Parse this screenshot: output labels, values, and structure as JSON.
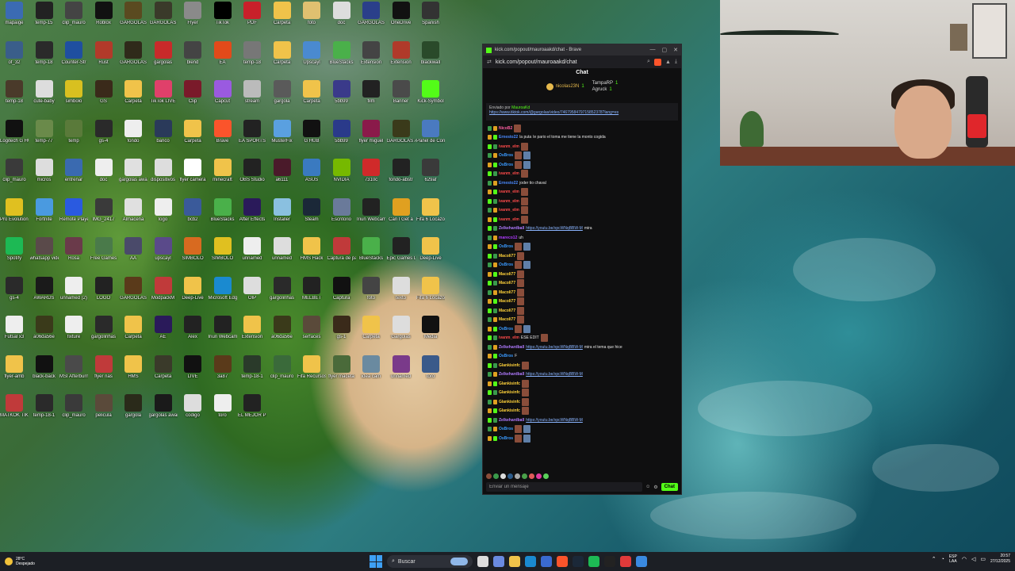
{
  "desktop": {
    "icons": [
      {
        "label": "mapaige",
        "color": "#3b6bb3"
      },
      {
        "label": "temp-15",
        "color": "#222"
      },
      {
        "label": "clip_mauro",
        "color": "#444"
      },
      {
        "label": "Roblox",
        "color": "#111"
      },
      {
        "label": "GARGOLAS",
        "color": "#5a4a20"
      },
      {
        "label": "GARGOLAS",
        "color": "#3a3a2a"
      },
      {
        "label": "Flyer",
        "color": "#8a8a8a"
      },
      {
        "label": "TikTok",
        "color": "#000"
      },
      {
        "label": "PDF",
        "color": "#c8202a"
      },
      {
        "label": "Carpeta",
        "color": "#f0c34a"
      },
      {
        "label": "foto",
        "color": "#e0c070"
      },
      {
        "label": "doc",
        "color": "#ddd"
      },
      {
        "label": "GARGOLAS",
        "color": "#2a3f8a"
      },
      {
        "label": "OneDrive",
        "color": "#111"
      },
      {
        "label": "Spanish",
        "color": "#333"
      },
      {
        "label": "of_32",
        "color": "#3a5e8a"
      },
      {
        "label": "temp-18",
        "color": "#2a2a2a"
      },
      {
        "label": "Counter-Str",
        "color": "#1f4fa0"
      },
      {
        "label": "Rust",
        "color": "#b23a2a"
      },
      {
        "label": "GARGOLAS",
        "color": "#2f2a1a"
      },
      {
        "label": "gargolas",
        "color": "#c82a2a"
      },
      {
        "label": "blend",
        "color": "#444"
      },
      {
        "label": "EA",
        "color": "#e24a1a"
      },
      {
        "label": "temp-18",
        "color": "#777"
      },
      {
        "label": "Carpeta",
        "color": "#f0c34a"
      },
      {
        "label": "Upscayl",
        "color": "#4a8ad0"
      },
      {
        "label": "BlueStacks",
        "color": "#4ab04a"
      },
      {
        "label": "Extension",
        "color": "#444"
      },
      {
        "label": "Extension",
        "color": "#b03a2a"
      },
      {
        "label": "blackwall",
        "color": "#2a4a2a"
      },
      {
        "label": "temp-18",
        "color": "#4a3a2a"
      },
      {
        "label": "cute-baby",
        "color": "#ddd"
      },
      {
        "label": "simbolo",
        "color": "#d8c020"
      },
      {
        "label": "GS",
        "color": "#3a2a1a"
      },
      {
        "label": "Carpeta",
        "color": "#f0c34a"
      },
      {
        "label": "TikTok LIVE",
        "color": "#e0406a"
      },
      {
        "label": "Clip",
        "color": "#7a1a2a"
      },
      {
        "label": "Capcut",
        "color": "#9a5ae0"
      },
      {
        "label": "stream",
        "color": "#bbb"
      },
      {
        "label": "gargola",
        "color": "#5a5a5a"
      },
      {
        "label": "Carpeta",
        "color": "#f0c34a"
      },
      {
        "label": "5bb99",
        "color": "#3a3a8a"
      },
      {
        "label": "film",
        "color": "#222"
      },
      {
        "label": "Banner",
        "color": "#4a4a4a"
      },
      {
        "label": "Kick-Symbol",
        "color": "#53fc18"
      },
      {
        "label": "Logitech G HUB",
        "color": "#111"
      },
      {
        "label": "temp-77",
        "color": "#6a8a4a"
      },
      {
        "label": "temp",
        "color": "#5a7a3a"
      },
      {
        "label": "gs-4",
        "color": "#2a2a2a"
      },
      {
        "label": "fondo",
        "color": "#eee"
      },
      {
        "label": "banco",
        "color": "#2a3a5a"
      },
      {
        "label": "Carpeta",
        "color": "#f0c34a"
      },
      {
        "label": "Brave",
        "color": "#fb542b"
      },
      {
        "label": "EA SPORTS",
        "color": "#222"
      },
      {
        "label": "MusterFix",
        "color": "#5aa0e0"
      },
      {
        "label": "G HUB",
        "color": "#111"
      },
      {
        "label": "5bb99",
        "color": "#2a3a8a"
      },
      {
        "label": "flyer miguel",
        "color": "#8a1a4a"
      },
      {
        "label": "GARGOLAS AWARDS",
        "color": "#3a3a1a"
      },
      {
        "label": "Panel de Control",
        "color": "#4a7ac0"
      },
      {
        "label": "clip_mauro",
        "color": "#3a3a3a"
      },
      {
        "label": "micros",
        "color": "#ddd"
      },
      {
        "label": "entrenar",
        "color": "#3a6ab0"
      },
      {
        "label": "doc",
        "color": "#eee"
      },
      {
        "label": "gargolas awards",
        "color": "#e0e0e0"
      },
      {
        "label": "dispositivos",
        "color": "#ddd"
      },
      {
        "label": "flyer camera",
        "color": "#fff"
      },
      {
        "label": "minecraft",
        "color": "#f0c34a"
      },
      {
        "label": "OBS Studio",
        "color": "#222"
      },
      {
        "label": "a6111",
        "color": "#4a1a2a"
      },
      {
        "label": "ASUS",
        "color": "#3a7ac0"
      },
      {
        "label": "NVIDIA",
        "color": "#76b900"
      },
      {
        "label": "7310c",
        "color": "#d02a2a"
      },
      {
        "label": "fondo-abstr",
        "color": "#222"
      },
      {
        "label": "629af",
        "color": "#3a3a3a"
      },
      {
        "label": "Pro Evolution Soccer",
        "color": "#e0c020"
      },
      {
        "label": "Fortnite",
        "color": "#4a9ae0"
      },
      {
        "label": "Remote Player",
        "color": "#2a5ae0"
      },
      {
        "label": "IMG_2417",
        "color": "#3a3a3a"
      },
      {
        "label": "Almacena",
        "color": "#e0e0e0"
      },
      {
        "label": "logo",
        "color": "#eee"
      },
      {
        "label": "bcb2",
        "color": "#3a5a9a"
      },
      {
        "label": "BlueStacks",
        "color": "#4ab04a"
      },
      {
        "label": "After Effects",
        "color": "#2a1a5a"
      },
      {
        "label": "Installer",
        "color": "#8ac0e0"
      },
      {
        "label": "Steam",
        "color": "#1b2838"
      },
      {
        "label": "Escritorio",
        "color": "#6a7a9a"
      },
      {
        "label": "Iriun Webcam",
        "color": "#222"
      },
      {
        "label": "Can I Get a",
        "color": "#e0a020"
      },
      {
        "label": "Fifa 6 Locazos",
        "color": "#f0c34a"
      },
      {
        "label": "Spotify",
        "color": "#1db954"
      },
      {
        "label": "whatsapp video",
        "color": "#5a4a4a"
      },
      {
        "label": "Rosa",
        "color": "#6a3a4a"
      },
      {
        "label": "Free Games",
        "color": "#4a7a4a"
      },
      {
        "label": "AA",
        "color": "#4a4a6a"
      },
      {
        "label": "upscayl",
        "color": "#5a4a8a"
      },
      {
        "label": "SIMBOLO",
        "color": "#d86a20"
      },
      {
        "label": "SIMBOLO",
        "color": "#e0c020"
      },
      {
        "label": "unnamed",
        "color": "#eee"
      },
      {
        "label": "unnamed",
        "color": "#ddd"
      },
      {
        "label": "HMS Hack",
        "color": "#f0c34a"
      },
      {
        "label": "Captura de pantalla",
        "color": "#c03a3a"
      },
      {
        "label": "BlueStacks",
        "color": "#4ab04a"
      },
      {
        "label": "Epic Games Launcher",
        "color": "#222"
      },
      {
        "label": "Deep-Live",
        "color": "#f0c34a"
      },
      {
        "label": "gs-4",
        "color": "#2a2a2a"
      },
      {
        "label": "AWARDS",
        "color": "#1a1a1a"
      },
      {
        "label": "unnamed (2)",
        "color": "#eee"
      },
      {
        "label": "LOGO",
        "color": "#222"
      },
      {
        "label": "GARGOLAS",
        "color": "#5a3a1a"
      },
      {
        "label": "ModpackM",
        "color": "#c03a3a"
      },
      {
        "label": "Deep-Live",
        "color": "#f0c34a"
      },
      {
        "label": "Microsoft Edge",
        "color": "#1a8ad0"
      },
      {
        "label": "OIP",
        "color": "#ddd"
      },
      {
        "label": "gargolinhas",
        "color": "#2a2a2a"
      },
      {
        "label": "MELBET",
        "color": "#222"
      },
      {
        "label": "Captura",
        "color": "#111"
      },
      {
        "label": "foto",
        "color": "#444"
      },
      {
        "label": "texto",
        "color": "#ddd"
      },
      {
        "label": "Fifa 6 Locazos",
        "color": "#f0c34a"
      },
      {
        "label": "Futsal x3",
        "color": "#eee"
      },
      {
        "label": "a06da56e",
        "color": "#3a3a1a"
      },
      {
        "label": "fixture",
        "color": "#eee"
      },
      {
        "label": "gargolinhas",
        "color": "#2a2a2a"
      },
      {
        "label": "Carpeta",
        "color": "#f0c34a"
      },
      {
        "label": "AE",
        "color": "#2a1a5a"
      },
      {
        "label": "Alex",
        "color": "#222"
      },
      {
        "label": "Iriun Webcam",
        "color": "#222"
      },
      {
        "label": "Extension",
        "color": "#f0c34a"
      },
      {
        "label": "a06da56e",
        "color": "#3a3a1a"
      },
      {
        "label": "serfaces",
        "color": "#5a4a3a"
      },
      {
        "label": "gs-1",
        "color": "#3a2a1a"
      },
      {
        "label": "Carpeta",
        "color": "#f0c34a"
      },
      {
        "label": "Gargolas",
        "color": "#ddd"
      },
      {
        "label": "Media",
        "color": "#111"
      },
      {
        "label": "flyer-amb",
        "color": "#f0c34a"
      },
      {
        "label": "black-back",
        "color": "#111"
      },
      {
        "label": "MSI Afterburner",
        "color": "#4a4a4a"
      },
      {
        "label": "flyer nas",
        "color": "#c03a3a"
      },
      {
        "label": "HMS",
        "color": "#f0c34a"
      },
      {
        "label": "Carpeta",
        "color": "#3a3a2a"
      },
      {
        "label": "LIVE",
        "color": "#111"
      },
      {
        "label": "3a87",
        "color": "#5a3a1a"
      },
      {
        "label": "temp-18-1",
        "color": "#2a3a2a"
      },
      {
        "label": "clip_mauro",
        "color": "#3a6a3a"
      },
      {
        "label": "Fifa Recursos",
        "color": "#f0c34a"
      },
      {
        "label": "flyer maceta",
        "color": "#4a6a3a"
      },
      {
        "label": "idea cam",
        "color": "#6a8aa0"
      },
      {
        "label": "unnamed",
        "color": "#7a3a8a"
      },
      {
        "label": "toro",
        "color": "#3a5a8a"
      },
      {
        "label": "MATKOK TIKTOK",
        "color": "#c03a3a"
      },
      {
        "label": "temp-18-1",
        "color": "#2a2a2a"
      },
      {
        "label": "clip_mauro",
        "color": "#3a3a3a"
      },
      {
        "label": "pelicula",
        "color": "#5a4a3a"
      },
      {
        "label": "gargola",
        "color": "#2a2a1a"
      },
      {
        "label": "gargolas awards",
        "color": "#1a1a1a"
      },
      {
        "label": "codigo",
        "color": "#ddd"
      },
      {
        "label": "toro",
        "color": "#eee"
      },
      {
        "label": "EL MEJOR PHONE",
        "color": "#222"
      }
    ]
  },
  "browser": {
    "title": "kick.com/popout/mauroaakd/chat - Brave",
    "url": "kick.com/popout/mauroaakd/chat"
  },
  "chat": {
    "header": "Chat",
    "gifters": [
      {
        "name": "nicolas23N",
        "count": "1"
      },
      {
        "name": "TampaRP",
        "count": "1"
      },
      {
        "name": "Agruck",
        "count": "1"
      }
    ],
    "pinned": {
      "label": "Enviado por",
      "user": "MauroaKd",
      "link": "https://www.tiktok.com/@gargolas/video/7467958479715852378?lang=es"
    },
    "messages": [
      {
        "user": "NicoB2",
        "color": "#ff5fa2",
        "text": "",
        "emotes": 1
      },
      {
        "user": "Ernesto22",
        "color": "#4a8aff",
        "text": "la puta",
        "extra": "le pario el toma me tiene la monto cogida",
        "emotes": 0
      },
      {
        "user": "ivanm_elm",
        "color": "#ff4a4a",
        "text": "",
        "emotes": 1
      },
      {
        "user": "OsBros",
        "color": "#3a9aff",
        "text": "",
        "emotes": 2
      },
      {
        "user": "OsBros",
        "color": "#3a9aff",
        "text": "",
        "emotes": 2
      },
      {
        "user": "ivanm_elm",
        "color": "#ff4a4a",
        "text": "",
        "emotes": 1
      },
      {
        "user": "Ernesto22",
        "color": "#4a8aff",
        "text": "joder tio chaval",
        "emotes": 0
      },
      {
        "user": "ivanm_elm",
        "color": "#ff4a4a",
        "text": "",
        "emotes": 1
      },
      {
        "user": "ivanm_elm",
        "color": "#ff4a4a",
        "text": "",
        "emotes": 1
      },
      {
        "user": "ivanm_elm",
        "color": "#ff4a4a",
        "text": "",
        "emotes": 1
      },
      {
        "user": "ivanm_elm",
        "color": "#ff4a4a",
        "text": "",
        "emotes": 1
      },
      {
        "user": "Zelkehardball",
        "color": "#b07aff",
        "text": "",
        "link": "https://youtu.be/xpcWNqBBW-M",
        "extra": "mira",
        "emotes": 0
      },
      {
        "user": "mareco12",
        "color": "#b03aff",
        "text": "uh",
        "emotes": 0
      },
      {
        "user": "OsBros",
        "color": "#3a9aff",
        "text": "",
        "emotes": 2
      },
      {
        "user": "Macoli77",
        "color": "#ffd23a",
        "text": "",
        "emotes": 1
      },
      {
        "user": "OsBros",
        "color": "#3a9aff",
        "text": "",
        "emotes": 2
      },
      {
        "user": "Macoli77",
        "color": "#ffd23a",
        "text": "",
        "emotes": 1
      },
      {
        "user": "Macoli77",
        "color": "#ffd23a",
        "text": "",
        "emotes": 1
      },
      {
        "user": "Macoli77",
        "color": "#ffd23a",
        "text": "",
        "emotes": 1
      },
      {
        "user": "Macoli77",
        "color": "#ffd23a",
        "text": "",
        "emotes": 1
      },
      {
        "user": "Macoli77",
        "color": "#ffd23a",
        "text": "",
        "emotes": 1
      },
      {
        "user": "Macoli77",
        "color": "#ffd23a",
        "text": "",
        "emotes": 1
      },
      {
        "user": "OsBros",
        "color": "#3a9aff",
        "text": "",
        "emotes": 2
      },
      {
        "user": "ivanm_elm",
        "color": "#ff4a4a",
        "text": "ESE EDIT",
        "emotes": 1
      },
      {
        "user": "Zelkehardball",
        "color": "#b07aff",
        "text": "",
        "link": "https://youtu.be/xpcWNqBBW-M",
        "extra": "mira el tema que hice",
        "emotes": 0
      },
      {
        "user": "OsBros",
        "color": "#3a9aff",
        "text": "F",
        "emotes": 0
      },
      {
        "user": "Glankisinfc",
        "color": "#ffd23a",
        "text": "",
        "emotes": 1
      },
      {
        "user": "Zelkehardball",
        "color": "#b07aff",
        "text": "",
        "link": "https://youtu.be/xpcWNqBBW-M",
        "emotes": 0
      },
      {
        "user": "Glankisinfc",
        "color": "#ffd23a",
        "text": "",
        "emotes": 1
      },
      {
        "user": "Glankisinfc",
        "color": "#ffd23a",
        "text": "",
        "emotes": 1
      },
      {
        "user": "Glankisinfc",
        "color": "#ffd23a",
        "text": "",
        "emotes": 1
      },
      {
        "user": "Glankisinfc",
        "color": "#ffd23a",
        "text": "",
        "emotes": 1
      },
      {
        "user": "Zelkehardball",
        "color": "#b07aff",
        "text": "",
        "link": "https://youtu.be/xpcWNqBBW-M",
        "emotes": 0
      },
      {
        "user": "OsBros",
        "color": "#3a9aff",
        "text": "",
        "emotes": 2
      },
      {
        "user": "OsBros",
        "color": "#3a9aff",
        "text": "",
        "emotes": 2
      }
    ],
    "input_placeholder": "Enviar un mensaje",
    "send_label": "Chat"
  },
  "taskbar": {
    "weather_temp": "28°C",
    "weather_desc": "Despejado",
    "search_label": "Buscar",
    "lang_top": "ESP",
    "lang_bottom": "LAA",
    "time": "20:57",
    "date": "27/12/2025",
    "apps": [
      {
        "name": "task-view",
        "color": "#ddd"
      },
      {
        "name": "copilot",
        "color": "#6a8ae0"
      },
      {
        "name": "file-explorer",
        "color": "#f0c34a"
      },
      {
        "name": "edge",
        "color": "#1a8ad0"
      },
      {
        "name": "store",
        "color": "#3a6ad0"
      },
      {
        "name": "brave",
        "color": "#fb542b"
      },
      {
        "name": "steam",
        "color": "#1b2838"
      },
      {
        "name": "spotify",
        "color": "#1db954"
      },
      {
        "name": "g-hub",
        "color": "#222"
      },
      {
        "name": "roblox-studio",
        "color": "#e03a3a"
      },
      {
        "name": "azure",
        "color": "#3a8ae0"
      }
    ]
  }
}
